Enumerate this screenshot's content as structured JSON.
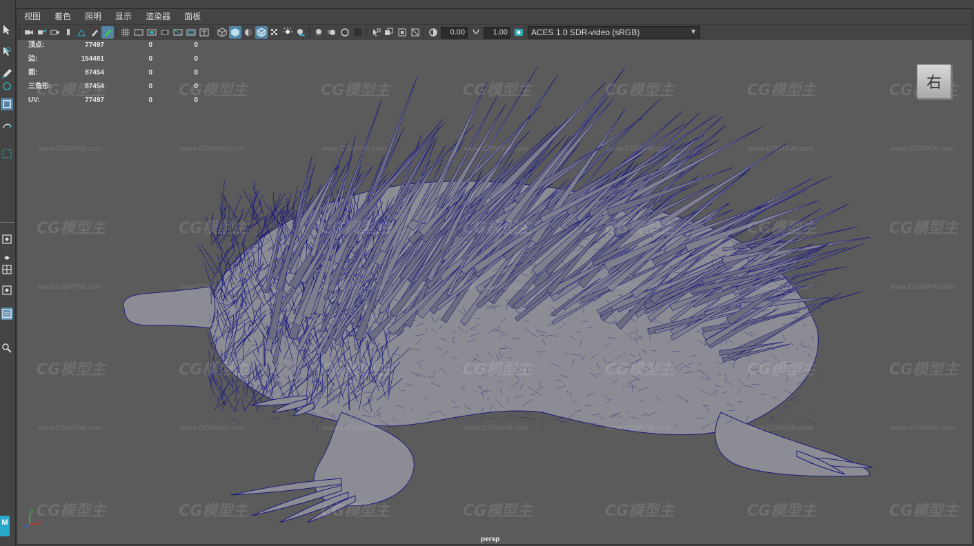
{
  "menu": {
    "view": "视图",
    "shading": "着色",
    "lighting": "照明",
    "show": "显示",
    "renderer": "渲染器",
    "panels": "面板"
  },
  "toolbar": {
    "exposure_value": "0.00",
    "gamma_value": "1.00",
    "colorspace": "ACES 1.0 SDR-video (sRGB)"
  },
  "hud": {
    "rows": [
      {
        "label": "顶点:",
        "v1": "77497",
        "v2": "0",
        "v3": "0"
      },
      {
        "label": "边:",
        "v1": "154481",
        "v2": "0",
        "v3": "0"
      },
      {
        "label": "面:",
        "v1": "87454",
        "v2": "0",
        "v3": "0"
      },
      {
        "label": "三角形:",
        "v1": "87454",
        "v2": "0",
        "v3": "0"
      },
      {
        "label": "UV:",
        "v1": "77497",
        "v2": "0",
        "v3": "0"
      }
    ]
  },
  "viewcube_label": "右",
  "camera": "persp",
  "watermark": {
    "logo": "CG模型主",
    "url": "www.CGMXW.com"
  },
  "colors": {
    "wire": "#1a1a7a",
    "mesh": "#8c8c94",
    "selected_tool": "#5285a6"
  },
  "axis": {
    "x": "x",
    "y": "y",
    "z": "z"
  },
  "app_logo": "M"
}
